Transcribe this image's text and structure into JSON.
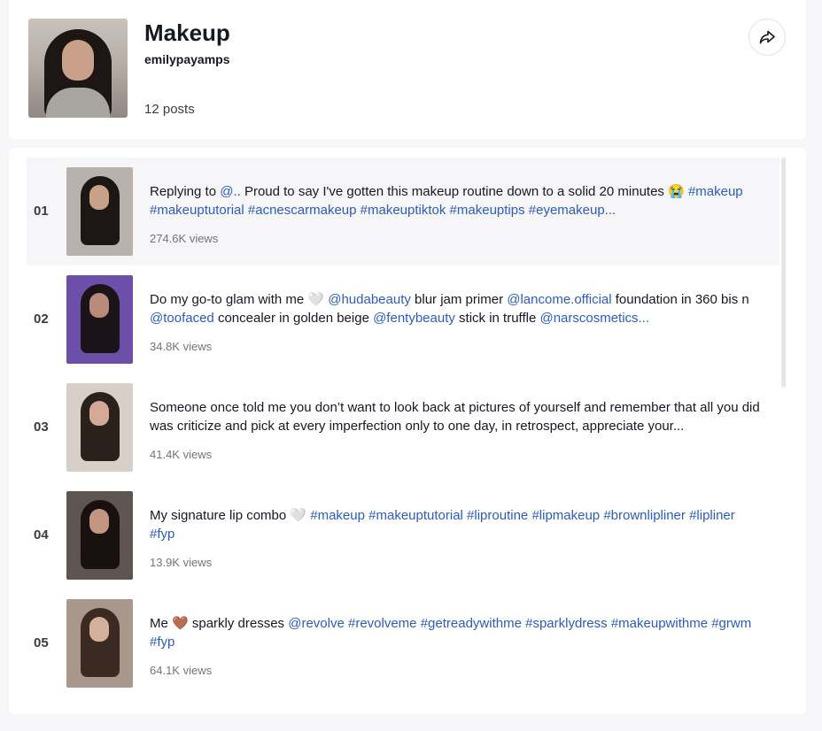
{
  "collection": {
    "title": "Makeup",
    "author": "emilypayamps",
    "post_count": "12 posts"
  },
  "icons": {
    "share": "share-arrow-icon"
  },
  "colors": {
    "hashtag": "#2b5db9",
    "active_row": "#f6f5f8"
  },
  "posts": [
    {
      "index": "01",
      "segments": [
        {
          "t": "Replying to ",
          "tag": false
        },
        {
          "t": "@..",
          "tag": true
        },
        {
          "t": " Proud to say I've gotten this makeup routine down to a solid 20 minutes 😭 ",
          "tag": false
        },
        {
          "t": "#makeup",
          "tag": true
        },
        {
          "t": " ",
          "tag": false
        },
        {
          "t": "#makeuptutorial",
          "tag": true
        },
        {
          "t": " ",
          "tag": false
        },
        {
          "t": "#acnescarmakeup",
          "tag": true
        },
        {
          "t": " ",
          "tag": false
        },
        {
          "t": "#makeuptiktok",
          "tag": true
        },
        {
          "t": " ",
          "tag": false
        },
        {
          "t": "#makeuptips",
          "tag": true
        },
        {
          "t": " ",
          "tag": false
        },
        {
          "t": "#eyemakeup...",
          "tag": true
        }
      ],
      "views": "274.6K views",
      "thumb": {
        "bg": "#b9b1ac",
        "hair": "#1c1614",
        "face": "#c9a08a"
      }
    },
    {
      "index": "02",
      "segments": [
        {
          "t": "Do my go-to glam with me 🤍 ",
          "tag": false
        },
        {
          "t": "@hudabeauty",
          "tag": true
        },
        {
          "t": " blur jam primer ",
          "tag": false
        },
        {
          "t": "@lancome.official",
          "tag": true
        },
        {
          "t": " foundation in 360 bis n ",
          "tag": false
        },
        {
          "t": "@toofaced",
          "tag": true
        },
        {
          "t": " concealer in golden beige ",
          "tag": false
        },
        {
          "t": "@fentybeauty",
          "tag": true
        },
        {
          "t": " stick in truffle ",
          "tag": false
        },
        {
          "t": "@narscosmetics...",
          "tag": true
        }
      ],
      "views": "34.8K views",
      "thumb": {
        "bg": "#6b4fa8",
        "hair": "#1a1318",
        "face": "#b98a7a"
      }
    },
    {
      "index": "03",
      "segments": [
        {
          "t": "Someone once told me you don’t want to look back at pictures of yourself and remember that all you did was criticize and pick at every imperfection only to one day, in retrospect, appreciate your...",
          "tag": false
        }
      ],
      "views": "41.4K views",
      "thumb": {
        "bg": "#d8cfc8",
        "hair": "#2a201c",
        "face": "#d6a896"
      }
    },
    {
      "index": "04",
      "segments": [
        {
          "t": "My signature lip combo 🤍 ",
          "tag": false
        },
        {
          "t": "#makeup",
          "tag": true
        },
        {
          "t": " ",
          "tag": false
        },
        {
          "t": "#makeuptutorial",
          "tag": true
        },
        {
          "t": " ",
          "tag": false
        },
        {
          "t": "#liproutine",
          "tag": true
        },
        {
          "t": " ",
          "tag": false
        },
        {
          "t": "#lipmakeup",
          "tag": true
        },
        {
          "t": " ",
          "tag": false
        },
        {
          "t": "#brownlipliner",
          "tag": true
        },
        {
          "t": " ",
          "tag": false
        },
        {
          "t": "#lipliner",
          "tag": true
        },
        {
          "t": " ",
          "tag": false
        },
        {
          "t": "#fyp",
          "tag": true
        }
      ],
      "views": "13.9K views",
      "thumb": {
        "bg": "#5e5451",
        "hair": "#17110f",
        "face": "#c49580"
      }
    },
    {
      "index": "05",
      "segments": [
        {
          "t": "Me 🤎 sparkly dresses ",
          "tag": false
        },
        {
          "t": "@revolve",
          "tag": true
        },
        {
          "t": " ",
          "tag": false
        },
        {
          "t": "#revolveme",
          "tag": true
        },
        {
          "t": " ",
          "tag": false
        },
        {
          "t": "#getreadywithme",
          "tag": true
        },
        {
          "t": " ",
          "tag": false
        },
        {
          "t": "#sparklydress",
          "tag": true
        },
        {
          "t": " ",
          "tag": false
        },
        {
          "t": "#makeupwithme",
          "tag": true
        },
        {
          "t": " ",
          "tag": false
        },
        {
          "t": "#grwm",
          "tag": true
        },
        {
          "t": " ",
          "tag": false
        },
        {
          "t": "#fyp",
          "tag": true
        }
      ],
      "views": "64.1K views",
      "thumb": {
        "bg": "#a8978a",
        "hair": "#3b2a22",
        "face": "#d4b19b"
      }
    }
  ]
}
